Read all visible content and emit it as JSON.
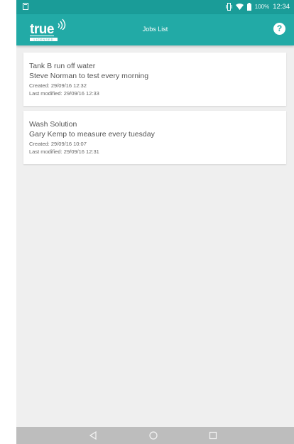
{
  "status_bar": {
    "battery_pct": "100%",
    "time": "12:34"
  },
  "app_bar": {
    "logo_text": "true",
    "logo_tagline": "LICENSED",
    "title": "Jobs List",
    "help_label": "?"
  },
  "jobs": [
    {
      "title": "Tank B run off water",
      "description": "Steve Norman to test every morning",
      "created": "Created: 29/09/16 12:32",
      "modified": "Last modified: 29/09/16 12:33"
    },
    {
      "title": "Wash Solution",
      "description": "Gary Kemp to measure every tuesday",
      "created": "Created: 29/09/16 10:07",
      "modified": "Last modified: 29/09/16 12:31"
    }
  ],
  "colors": {
    "status_bar": "#1a9c98",
    "app_bar": "#22aaa6",
    "background": "#efefef",
    "nav_bar": "#bdbdbd"
  },
  "icons": {
    "help": "help-circle-icon",
    "back": "back-triangle-icon",
    "home": "home-circle-icon",
    "recent": "recent-apps-square-icon"
  }
}
